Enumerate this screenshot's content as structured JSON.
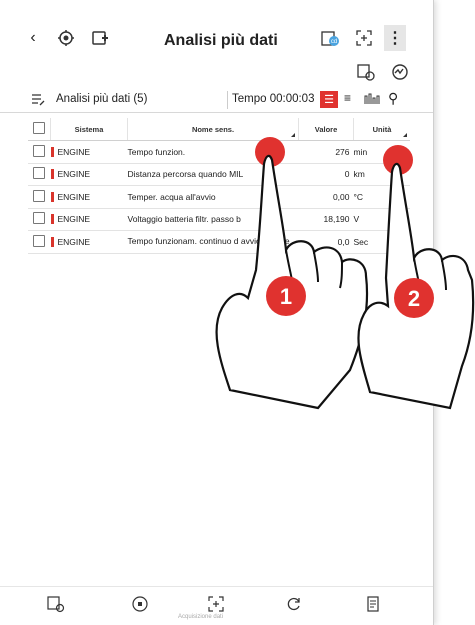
{
  "header": {
    "title": "Analisi più dati",
    "back_icon": "chevron-left-icon",
    "left_icons": [
      "gear-refresh-icon",
      "car-add-icon"
    ],
    "right_icons": [
      "cd-icon",
      "capture-icon",
      "kebab-menu-icon"
    ]
  },
  "sub_toolbar": {
    "icons": [
      "car-settings-icon",
      "gauge-icon"
    ]
  },
  "toolbar": {
    "list_label": "Analisi più dati (5)",
    "tempo_label": "Tempo 00:00:03",
    "view_icons": [
      "list-view-icon",
      "text-view-icon",
      "graph-view-icon",
      "search-icon"
    ]
  },
  "table": {
    "columns": [
      "Sistema",
      "Nome sens.",
      "Valore",
      "Unità"
    ],
    "rows": [
      {
        "sistema": "ENGINE",
        "nome": "Tempo funzion.",
        "valore": "276",
        "unita": "min"
      },
      {
        "sistema": "ENGINE",
        "nome": "Distanza percorsa quando MIL",
        "valore": "0",
        "unita": "km"
      },
      {
        "sistema": "ENGINE",
        "nome": "Temper. acqua all'avvio",
        "valore": "0,00",
        "unita": "°C"
      },
      {
        "sistema": "ENGINE",
        "nome": "Voltaggio batteria filtr. passo b",
        "valore": "18,190",
        "unita": "V"
      },
      {
        "sistema": "ENGINE",
        "nome": "Tempo funzionam. continuo d avvio motore",
        "valore": "0,0",
        "unita": "Sec"
      }
    ]
  },
  "bottom_bar": {
    "icons": [
      "car-connect-icon",
      "record-icon",
      "capture-icon",
      "refresh-icon",
      "report-icon"
    ],
    "faded_label": "Acquisizione dati"
  },
  "overlay": {
    "marker_1": "1",
    "marker_2": "2",
    "accent": "#e0322f"
  }
}
